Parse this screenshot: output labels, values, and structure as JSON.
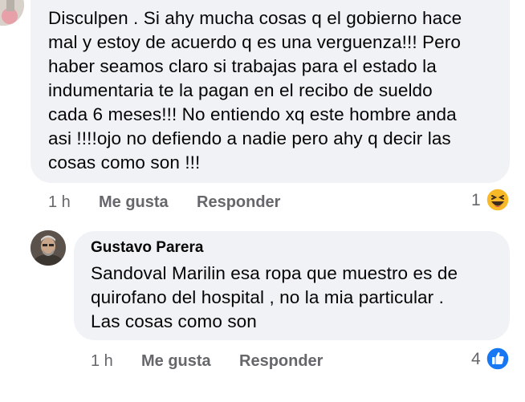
{
  "comments": [
    {
      "text": "Disculpen . Si ahy mucha cosas q el gobierno hace\nmal y estoy de acuerdo q es una verguenza!!! Pero\nhaber seamos claro si trabajas para el estado la\nindumentaria te la pagan en el recibo de sueldo\ncada 6 meses!!! No entiendo xq este hombre anda\nasi !!!!ojo no defiendo a nadie pero ahy q decir las\ncosas como son !!!",
      "time": "1 h",
      "like_label": "Me gusta",
      "reply_label": "Responder",
      "reaction_count": "1",
      "reaction_icon": "haha-emoji-icon"
    },
    {
      "author": "Gustavo Parera",
      "text": "Sandoval Marilin  esa ropa que muestro es de\nquirofano del hospital , no la mia particular .\nLas cosas como son",
      "time": "1 h",
      "like_label": "Me gusta",
      "reply_label": "Responder",
      "reaction_count": "4",
      "reaction_icon": "like-thumb-icon"
    }
  ],
  "colors": {
    "bubble": "#f0f2f5",
    "meta": "#65676b",
    "like_blue": "#1877f2",
    "haha_yellow": "#f7b928"
  }
}
